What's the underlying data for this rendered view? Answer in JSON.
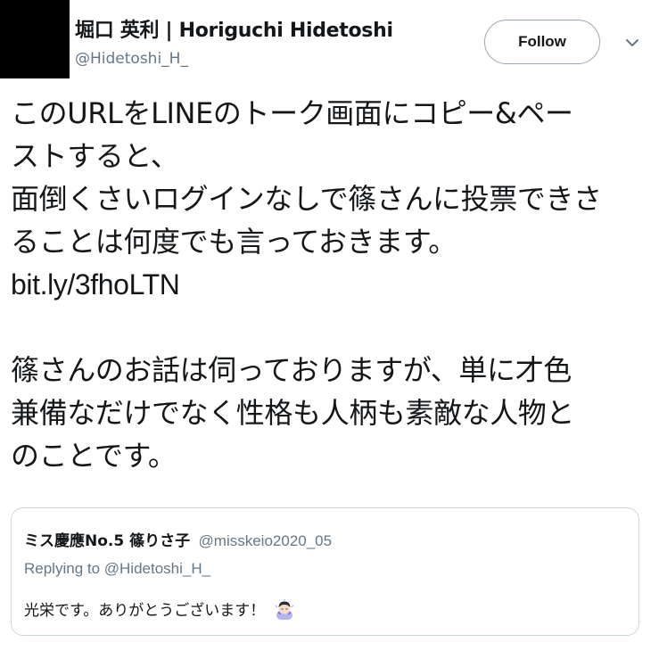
{
  "author": {
    "display_name": "堀口 英利 | Horiguchi Hidetoshi",
    "handle": "@Hidetoshi_H_",
    "avatar_icon": "avatar-redacted",
    "avatar_color": "#000000"
  },
  "actions": {
    "follow_label": "Follow",
    "menu_icon": "chevron-down-icon"
  },
  "tweet": {
    "lines": [
      "このURLをLINEのトーク画面にコピー&ペー",
      "ストすると、",
      "面倒くさいログインなしで篠さんに投票できさ",
      "ることは何度でも言っておきます。"
    ],
    "link": "bit.ly/3fhoLTN",
    "lines2": [
      "篠さんのお話は伺っておりますが、単に才色",
      "兼備なだけでなく性格も人柄も素敵な人物と",
      "のことです。"
    ]
  },
  "quote": {
    "name": "ミス慶應No.5 篠りさ子",
    "handle": "@misskeio2020_05",
    "replying": "Replying to @Hidetoshi_H_",
    "text": "光栄です。ありがとうございます！",
    "emoji_icon": "person-bowing-icon"
  },
  "colors": {
    "text": "#14171a",
    "secondary": "#657786",
    "border": "#ccd6dd",
    "background": "#ffffff"
  }
}
